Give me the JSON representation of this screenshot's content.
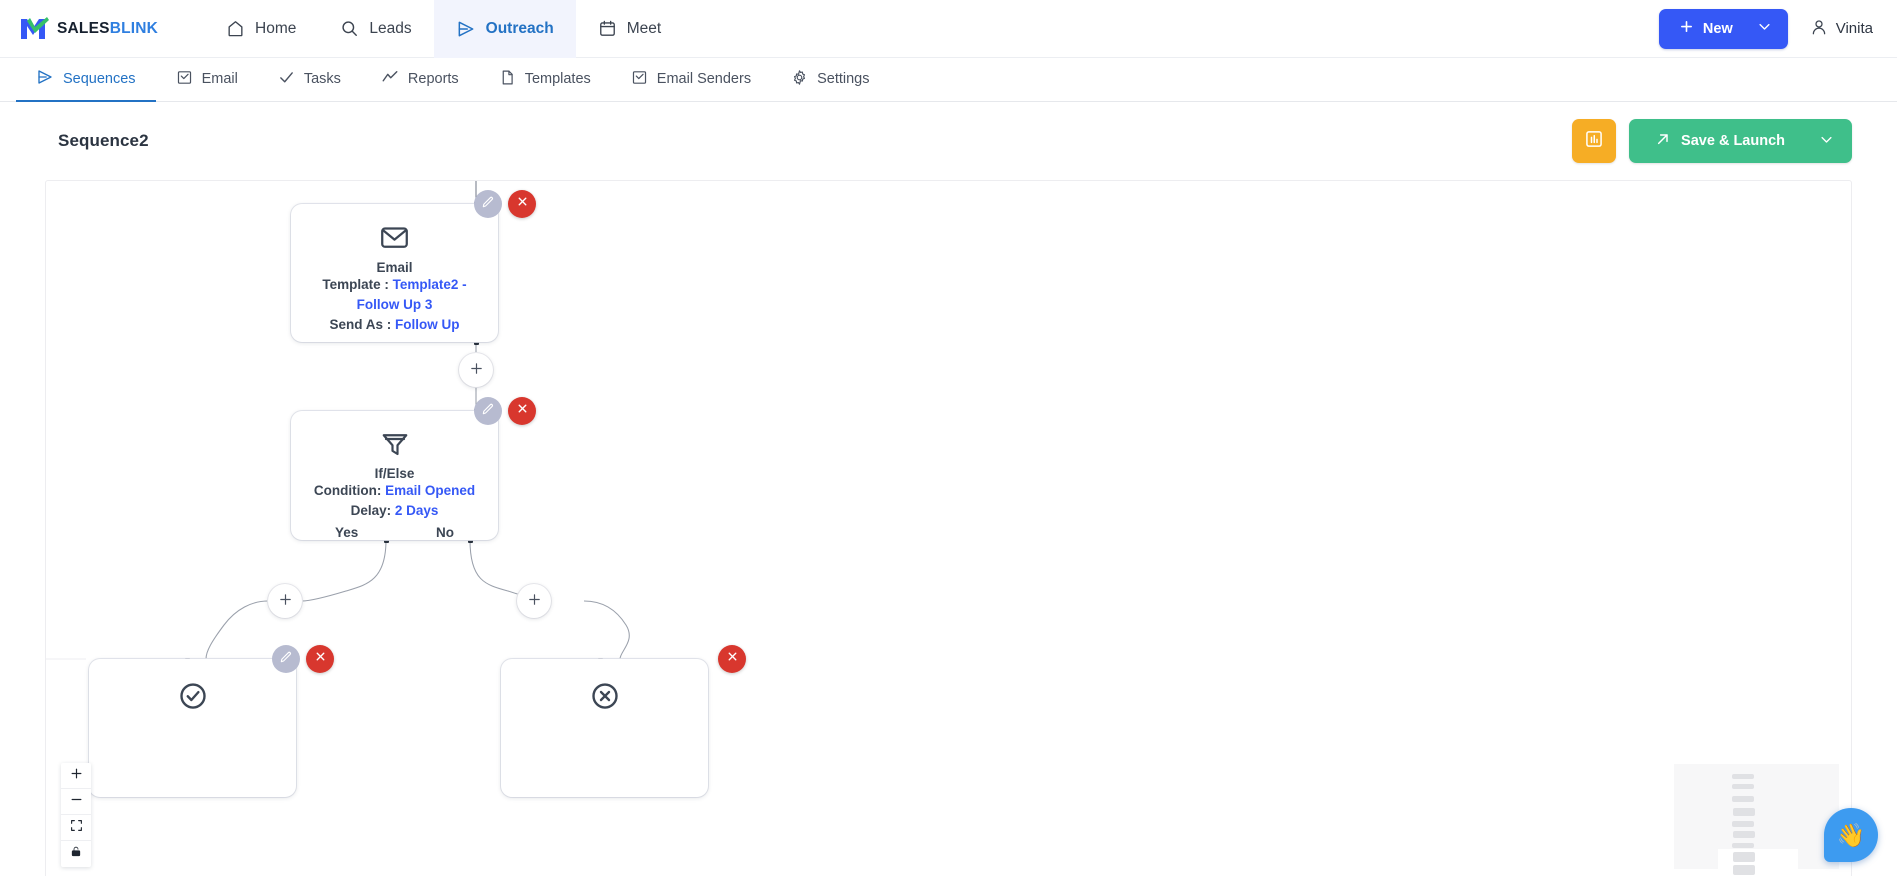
{
  "brand": {
    "part1": "SALES",
    "part2": "BLINK",
    "icon": "salesblink-logo-icon"
  },
  "topnav": {
    "items": [
      {
        "label": "Home",
        "icon": "home-icon",
        "active": false
      },
      {
        "label": "Leads",
        "icon": "search-icon",
        "active": false
      },
      {
        "label": "Outreach",
        "icon": "send-icon",
        "active": true
      },
      {
        "label": "Meet",
        "icon": "calendar-icon",
        "active": false
      }
    ],
    "new_button": {
      "label": "New",
      "icon": "plus-icon",
      "caret": "chevron-down-icon"
    },
    "user": {
      "name": "Vinita",
      "icon": "user-icon"
    }
  },
  "subnav": {
    "items": [
      {
        "label": "Sequences",
        "icon": "send-icon",
        "active": true
      },
      {
        "label": "Email",
        "icon": "mail-check-icon",
        "active": false
      },
      {
        "label": "Tasks",
        "icon": "check-icon",
        "active": false
      },
      {
        "label": "Reports",
        "icon": "trend-icon",
        "active": false
      },
      {
        "label": "Templates",
        "icon": "file-icon",
        "active": false
      },
      {
        "label": "Email Senders",
        "icon": "mail-check-icon",
        "active": false
      },
      {
        "label": "Settings",
        "icon": "gear-icon",
        "active": false
      }
    ]
  },
  "page": {
    "title": "Sequence2",
    "analytics_button": {
      "icon": "bar-chart-icon"
    },
    "launch_button": {
      "label": "Save & Launch",
      "icon": "arrow-up-right-icon",
      "caret": "chevron-down-icon"
    }
  },
  "flow": {
    "nodes": [
      {
        "id": "email",
        "type": "Email",
        "icon": "envelope-icon",
        "title": "Email",
        "fields": [
          {
            "label": "Template : ",
            "value": "Template2 - Follow Up 3"
          },
          {
            "label": "Send As : ",
            "value": "Follow Up"
          }
        ],
        "actions": {
          "edit": "pencil-icon",
          "delete": "close-icon"
        }
      },
      {
        "id": "ifelse",
        "type": "If/Else",
        "icon": "funnel-icon",
        "title": "If/Else",
        "fields": [
          {
            "label": "Condition: ",
            "value": "Email Opened"
          },
          {
            "label": "Delay: ",
            "value": "2 Days"
          }
        ],
        "branches": [
          "Yes",
          "No"
        ],
        "actions": {
          "edit": "pencil-icon",
          "delete": "close-icon"
        }
      },
      {
        "id": "yes-branch",
        "type": "Success",
        "icon": "check-circle-icon",
        "title": "",
        "actions": {
          "edit": "pencil-icon",
          "delete": "close-icon"
        }
      },
      {
        "id": "no-branch",
        "type": "Failure",
        "icon": "x-circle-icon",
        "title": "",
        "actions": {
          "delete": "close-icon"
        }
      }
    ],
    "add_buttons": [
      {
        "id": "add-after-email",
        "label": "+"
      },
      {
        "id": "add-yes-branch",
        "label": "+"
      },
      {
        "id": "add-no-branch",
        "label": "+"
      }
    ],
    "controls": [
      {
        "id": "zoom-in",
        "icon": "plus-icon"
      },
      {
        "id": "zoom-out",
        "icon": "minus-icon"
      },
      {
        "id": "fit-view",
        "icon": "fit-view-icon"
      },
      {
        "id": "lock",
        "icon": "lock-icon"
      }
    ],
    "minimap": {
      "id": "minimap"
    }
  },
  "chat": {
    "icon": "waving-hand-icon",
    "glyph": "👋"
  },
  "colors": {
    "brand_blue": "#2372c4",
    "accent_blue": "#3558f6",
    "link_blue": "#3558f6",
    "green": "#3fbf8a",
    "amber": "#f6ad25",
    "red": "#d8372e",
    "grey": "#b7bbd0",
    "text": "#3c4654"
  }
}
